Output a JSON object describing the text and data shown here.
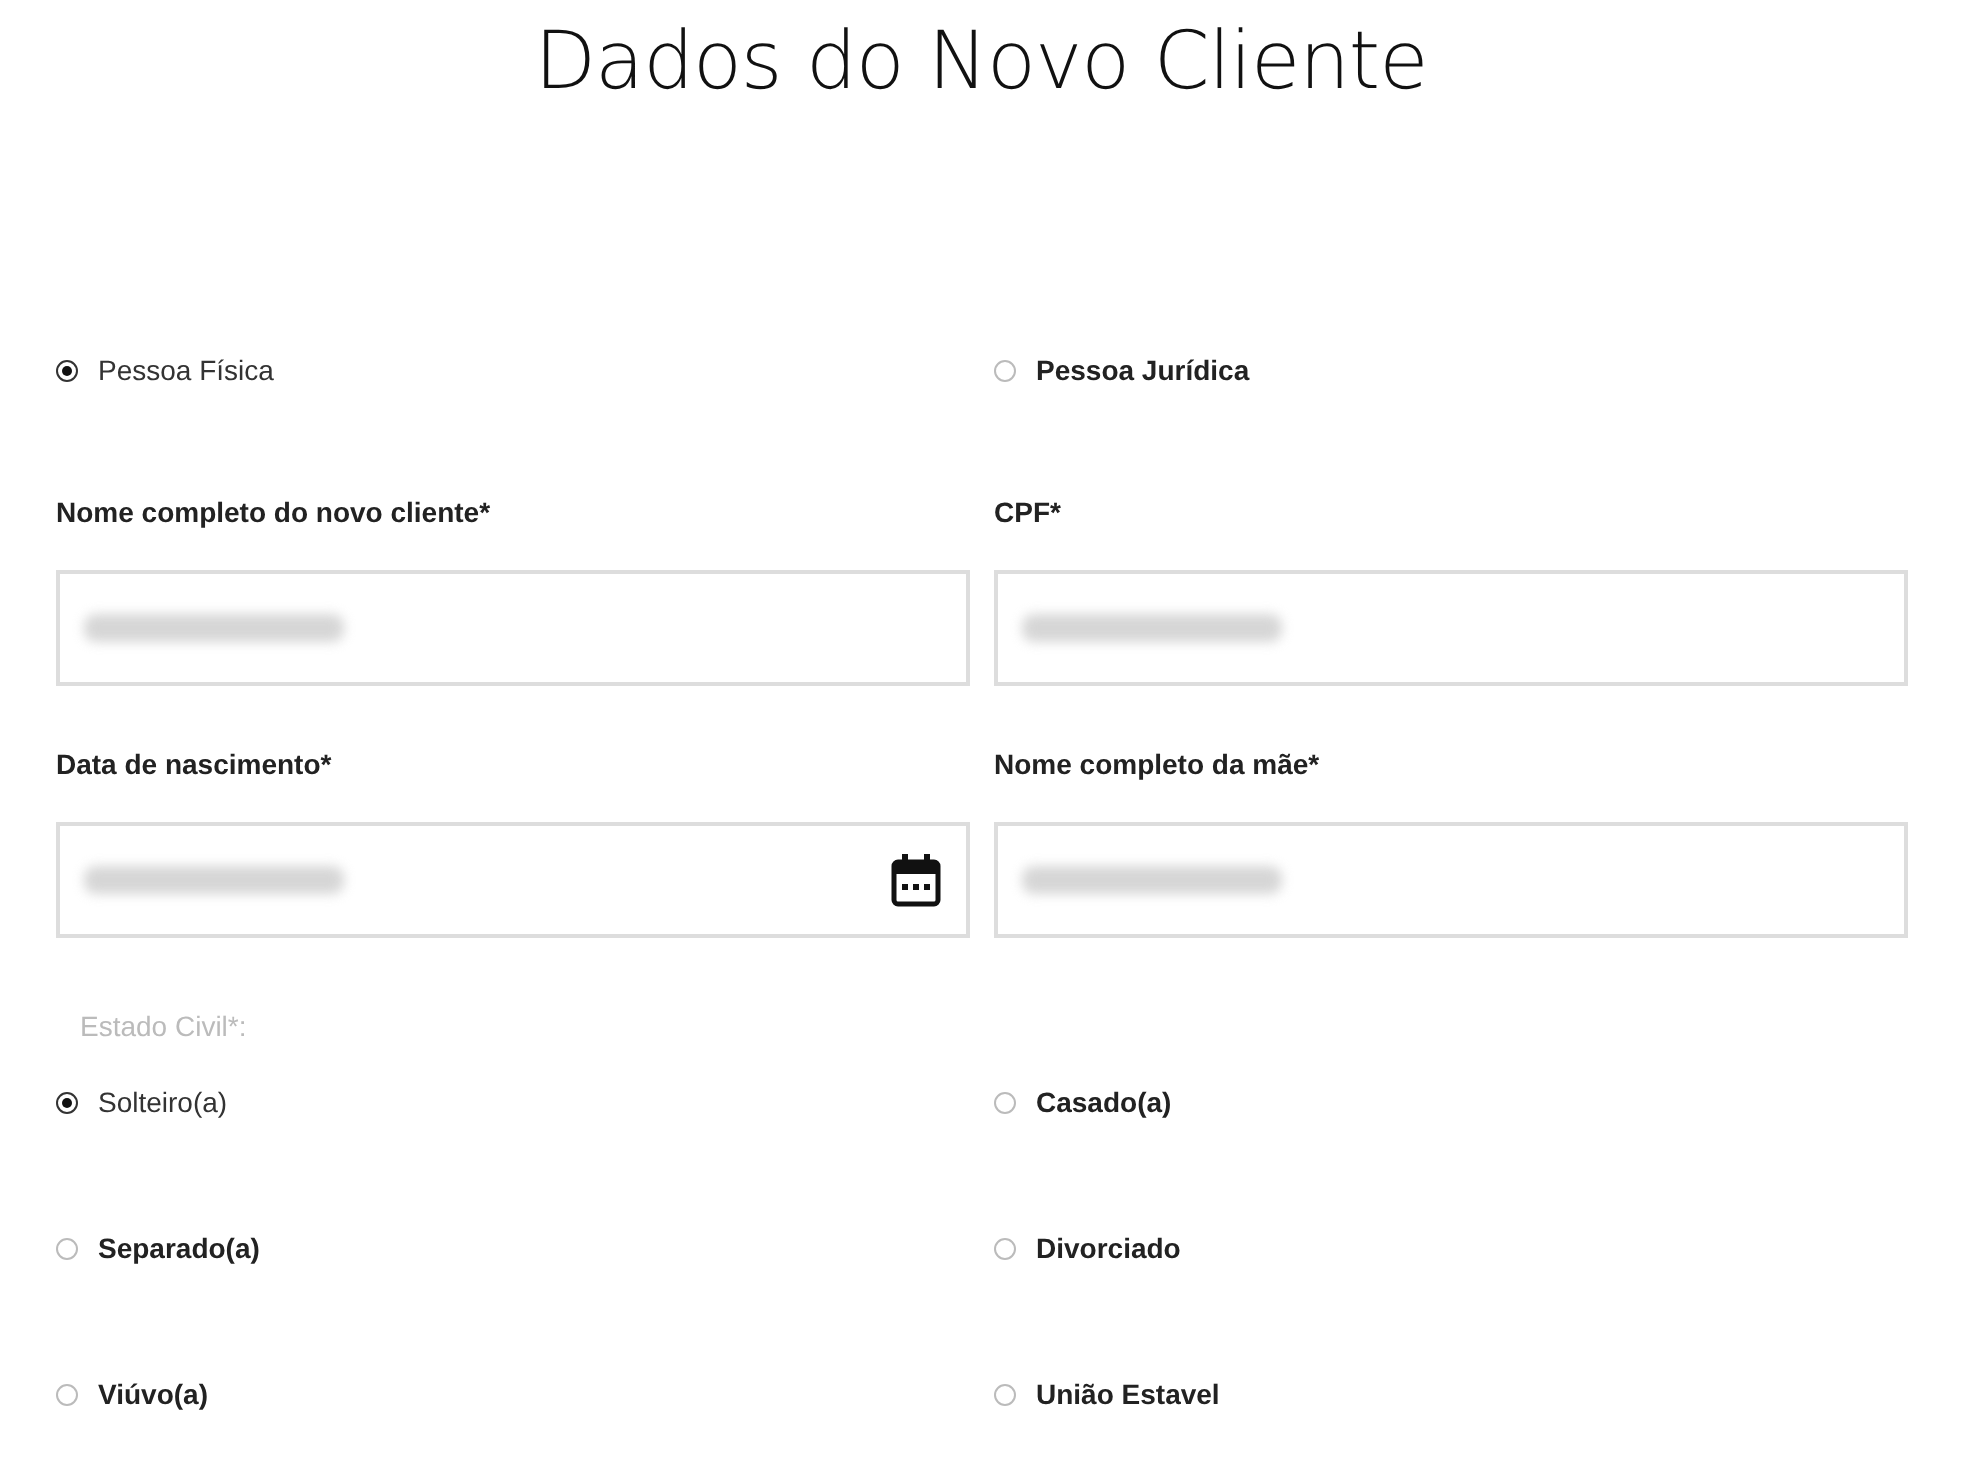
{
  "title": "Dados do Novo Cliente",
  "person_type": [
    {
      "label": "Pessoa Física",
      "selected": true
    },
    {
      "label": "Pessoa Jurídica",
      "selected": false
    }
  ],
  "fields": [
    {
      "label": "Nome completo do novo cliente*",
      "kind": "text",
      "redacted": true
    },
    {
      "label": "CPF*",
      "kind": "text",
      "redacted": true
    },
    {
      "label": "Data de nascimento*",
      "kind": "date",
      "redacted": true
    },
    {
      "label": "Nome completo da mãe*",
      "kind": "text",
      "redacted": true
    }
  ],
  "marital_status": {
    "label": "Estado Civil*:",
    "options": [
      {
        "label": "Solteiro(a)",
        "selected": true
      },
      {
        "label": "Casado(a)",
        "selected": false
      },
      {
        "label": "Separado(a)",
        "selected": false
      },
      {
        "label": "Divorciado",
        "selected": false
      },
      {
        "label": "Viúvo(a)",
        "selected": false
      },
      {
        "label": "União Estavel",
        "selected": false
      }
    ]
  }
}
